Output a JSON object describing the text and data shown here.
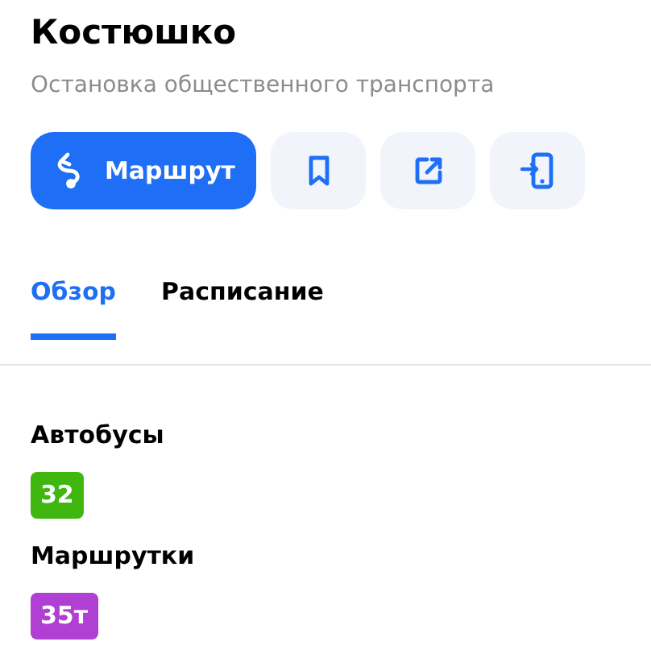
{
  "title": "Костюшко",
  "subtitle": "Остановка общественного транспорта",
  "route_button": {
    "label": "Маршрут"
  },
  "tabs": [
    {
      "label": "Обзор",
      "selected": true
    },
    {
      "label": "Расписание",
      "selected": false
    }
  ],
  "sections": [
    {
      "title": "Автобусы",
      "routes": [
        {
          "number": "32",
          "color": "#3fb70f"
        }
      ]
    },
    {
      "title": "Маршрутки",
      "routes": [
        {
          "number": "35т",
          "color": "#b03fd3"
        }
      ]
    }
  ]
}
